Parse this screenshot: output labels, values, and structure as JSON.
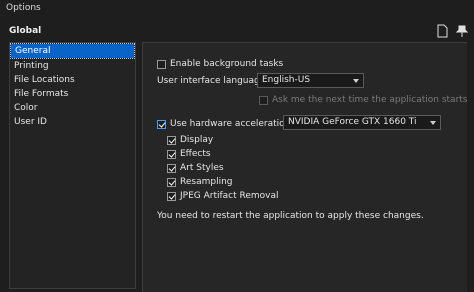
{
  "window": {
    "title": "Options"
  },
  "header": {
    "section": "Global"
  },
  "sidebar": {
    "items": [
      {
        "label": "General",
        "selected": true
      },
      {
        "label": "Printing"
      },
      {
        "label": "File Locations"
      },
      {
        "label": "File Formats"
      },
      {
        "label": "Color"
      },
      {
        "label": "User ID"
      }
    ]
  },
  "general": {
    "background_tasks": {
      "label": "Enable background tasks",
      "checked": false
    },
    "language": {
      "label": "User interface language:",
      "value": "English-US"
    },
    "ask_next_time": {
      "label": "Ask me the next time the application starts",
      "checked": false,
      "disabled": true
    },
    "hw_accel": {
      "label": "Use hardware acceleration:",
      "checked": true,
      "gpu": "NVIDIA GeForce GTX 1660 Ti"
    },
    "hw_options": [
      {
        "label": "Display",
        "checked": true
      },
      {
        "label": "Effects",
        "checked": true
      },
      {
        "label": "Art Styles",
        "checked": true
      },
      {
        "label": "Resampling",
        "checked": true
      },
      {
        "label": "JPEG Artifact Removal",
        "checked": true
      }
    ],
    "restart_note": "You need to restart the application to apply these changes."
  },
  "icons": {
    "header_left": "page-icon",
    "header_right": "pin-icon"
  },
  "colors": {
    "selection": "#0a64c8",
    "background": "#1e1e1e",
    "panel": "#262626"
  }
}
